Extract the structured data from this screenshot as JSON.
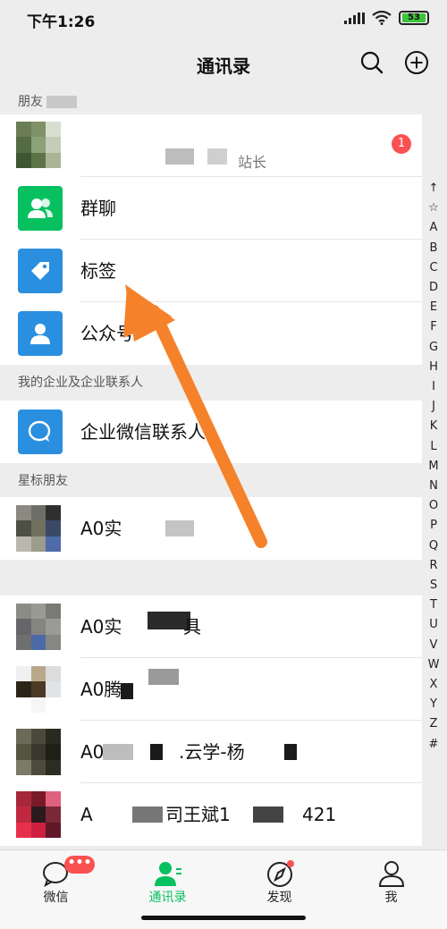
{
  "status_bar": {
    "time": "下午1:26",
    "battery": "53"
  },
  "nav": {
    "title": "通讯录"
  },
  "sections": {
    "friends": "朋友",
    "enterprise": "我的企业及企业联系人",
    "starred": "星标朋友"
  },
  "rows": {
    "friend_subtitle": "站长",
    "friend_badge": "1",
    "group_chat": "群聊",
    "tags": "标签",
    "official": "公众号",
    "enterprise_contact": "企业微信联系人",
    "starred_contact": "A0实",
    "contact_1": "A0实",
    "contact_1_suffix": "具",
    "contact_2": "A0腾",
    "contact_3_prefix": "A0",
    "contact_3": ".云学-杨",
    "contact_4_prefix": "A",
    "contact_4": "司王斌1",
    "contact_4_suffix": "421"
  },
  "index": [
    "↑",
    "☆",
    "A",
    "B",
    "C",
    "D",
    "E",
    "F",
    "G",
    "H",
    "I",
    "J",
    "K",
    "L",
    "M",
    "N",
    "O",
    "P",
    "Q",
    "R",
    "S",
    "T",
    "U",
    "V",
    "W",
    "X",
    "Y",
    "Z",
    "#"
  ],
  "tabs": {
    "chats": "微信",
    "contacts": "通讯录",
    "discover": "发现",
    "me": "我"
  },
  "colors": {
    "brand_green": "#07c160",
    "icon_blue": "#2b8fe0",
    "badge_red": "#fa5151",
    "arrow_orange": "#f5822a"
  }
}
